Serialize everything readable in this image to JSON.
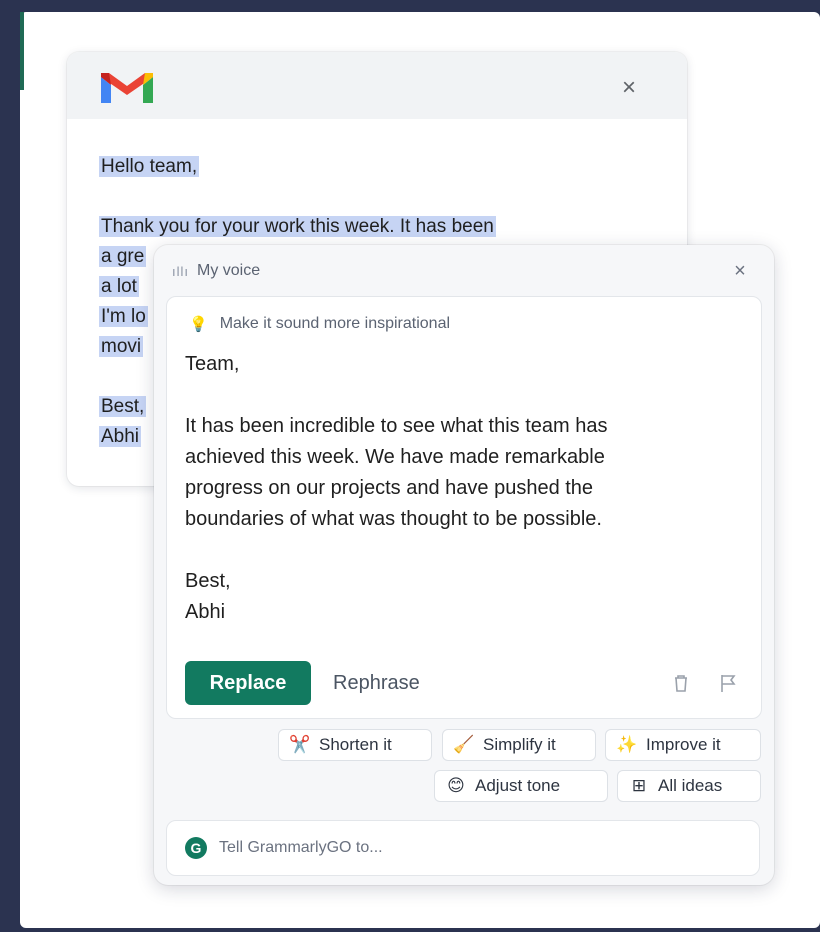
{
  "gmail": {
    "logo_icon": "gmail-logo-icon",
    "close_icon": "close-icon",
    "body_lines": [
      "Hello team,",
      "",
      "Thank you for your work this week. It has been",
      "a gre",
      "a lot",
      "I'm lo",
      "movi",
      "",
      "Best,",
      "Abhi"
    ]
  },
  "panel": {
    "voice_label": "My voice",
    "prompt": "Make it sound more inspirational",
    "result_lines": [
      "Team,",
      "",
      "It has been incredible to see what this team has",
      "achieved this week. We have made remarkable",
      "progress on our projects and have pushed the",
      "boundaries of what was thought to be possible.",
      "",
      "Best,",
      "Abhi"
    ],
    "replace_label": "Replace",
    "rephrase_label": "Rephrase",
    "chips": {
      "shorten": "Shorten it",
      "simplify": "Simplify it",
      "improve": "Improve it",
      "adjust": "Adjust tone",
      "all": "All ideas"
    },
    "input_placeholder": "Tell GrammarlyGO to...",
    "accent_color": "#127a60"
  }
}
